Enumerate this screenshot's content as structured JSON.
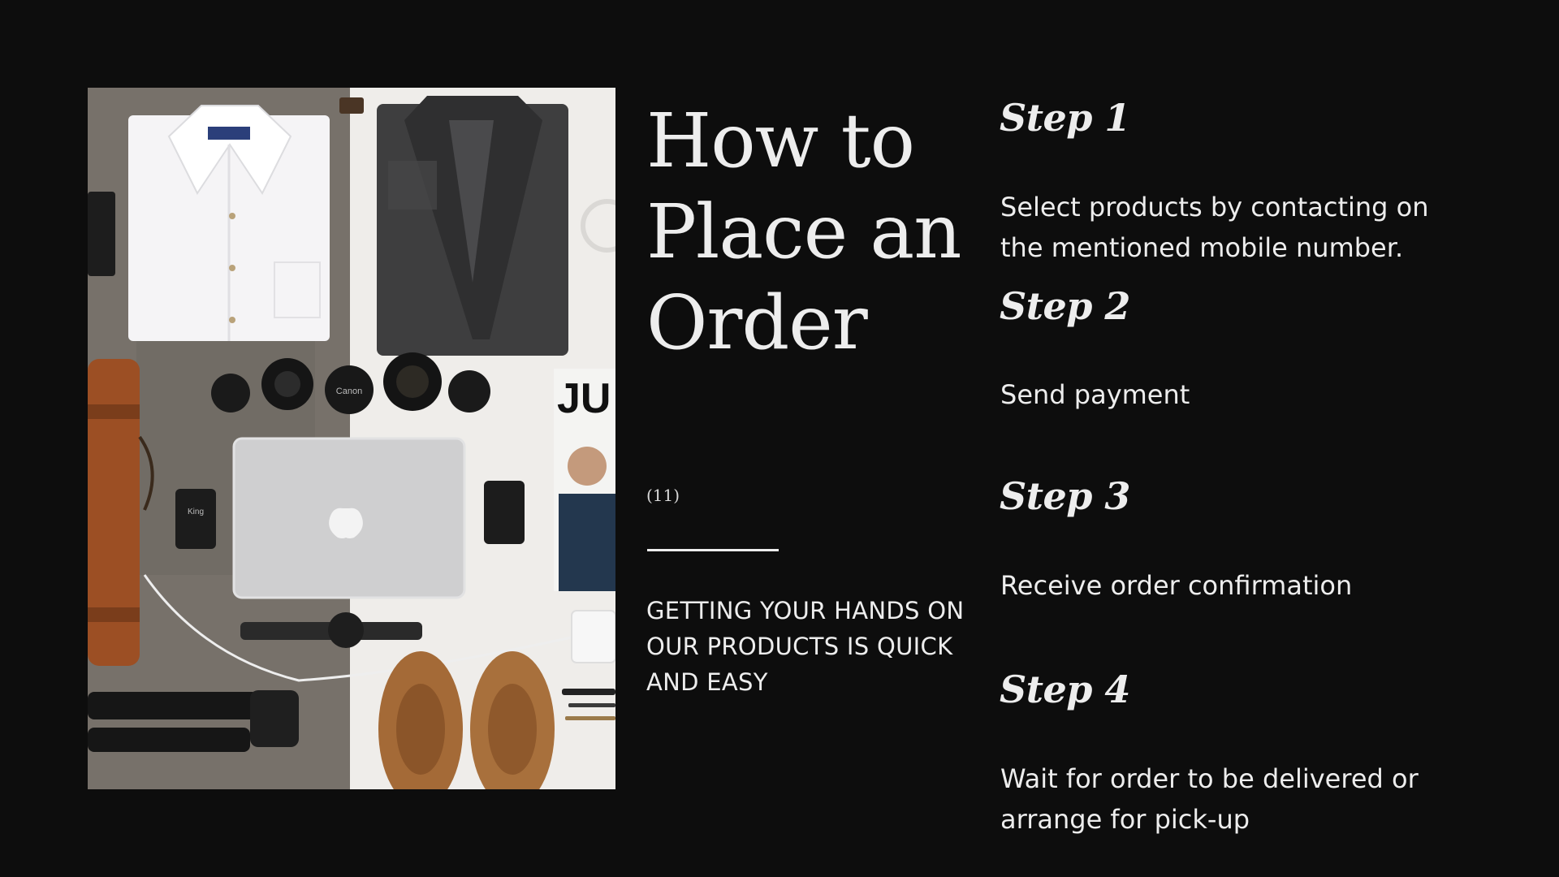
{
  "title": {
    "line1": "How to",
    "line2": "Place an",
    "line3": "Order"
  },
  "page_number": "(11)",
  "tagline": "GETTING YOUR HANDS ON OUR PRODUCTS IS QUICK AND EASY",
  "photo": {
    "magazine_masthead": "JU",
    "lens_cap_brand": "Canon",
    "flash_brand": "King"
  },
  "steps": [
    {
      "heading": "Step 1",
      "description": "Select products by contacting on the mentioned mobile number."
    },
    {
      "heading": "Step 2",
      "description": "Send payment"
    },
    {
      "heading": "Step 3",
      "description": "Receive order confirmation"
    },
    {
      "heading": "Step 4",
      "description": "Wait for order to be delivered or arrange for pick-up"
    }
  ],
  "colors": {
    "background": "#0d0d0d",
    "text": "#ededed"
  }
}
